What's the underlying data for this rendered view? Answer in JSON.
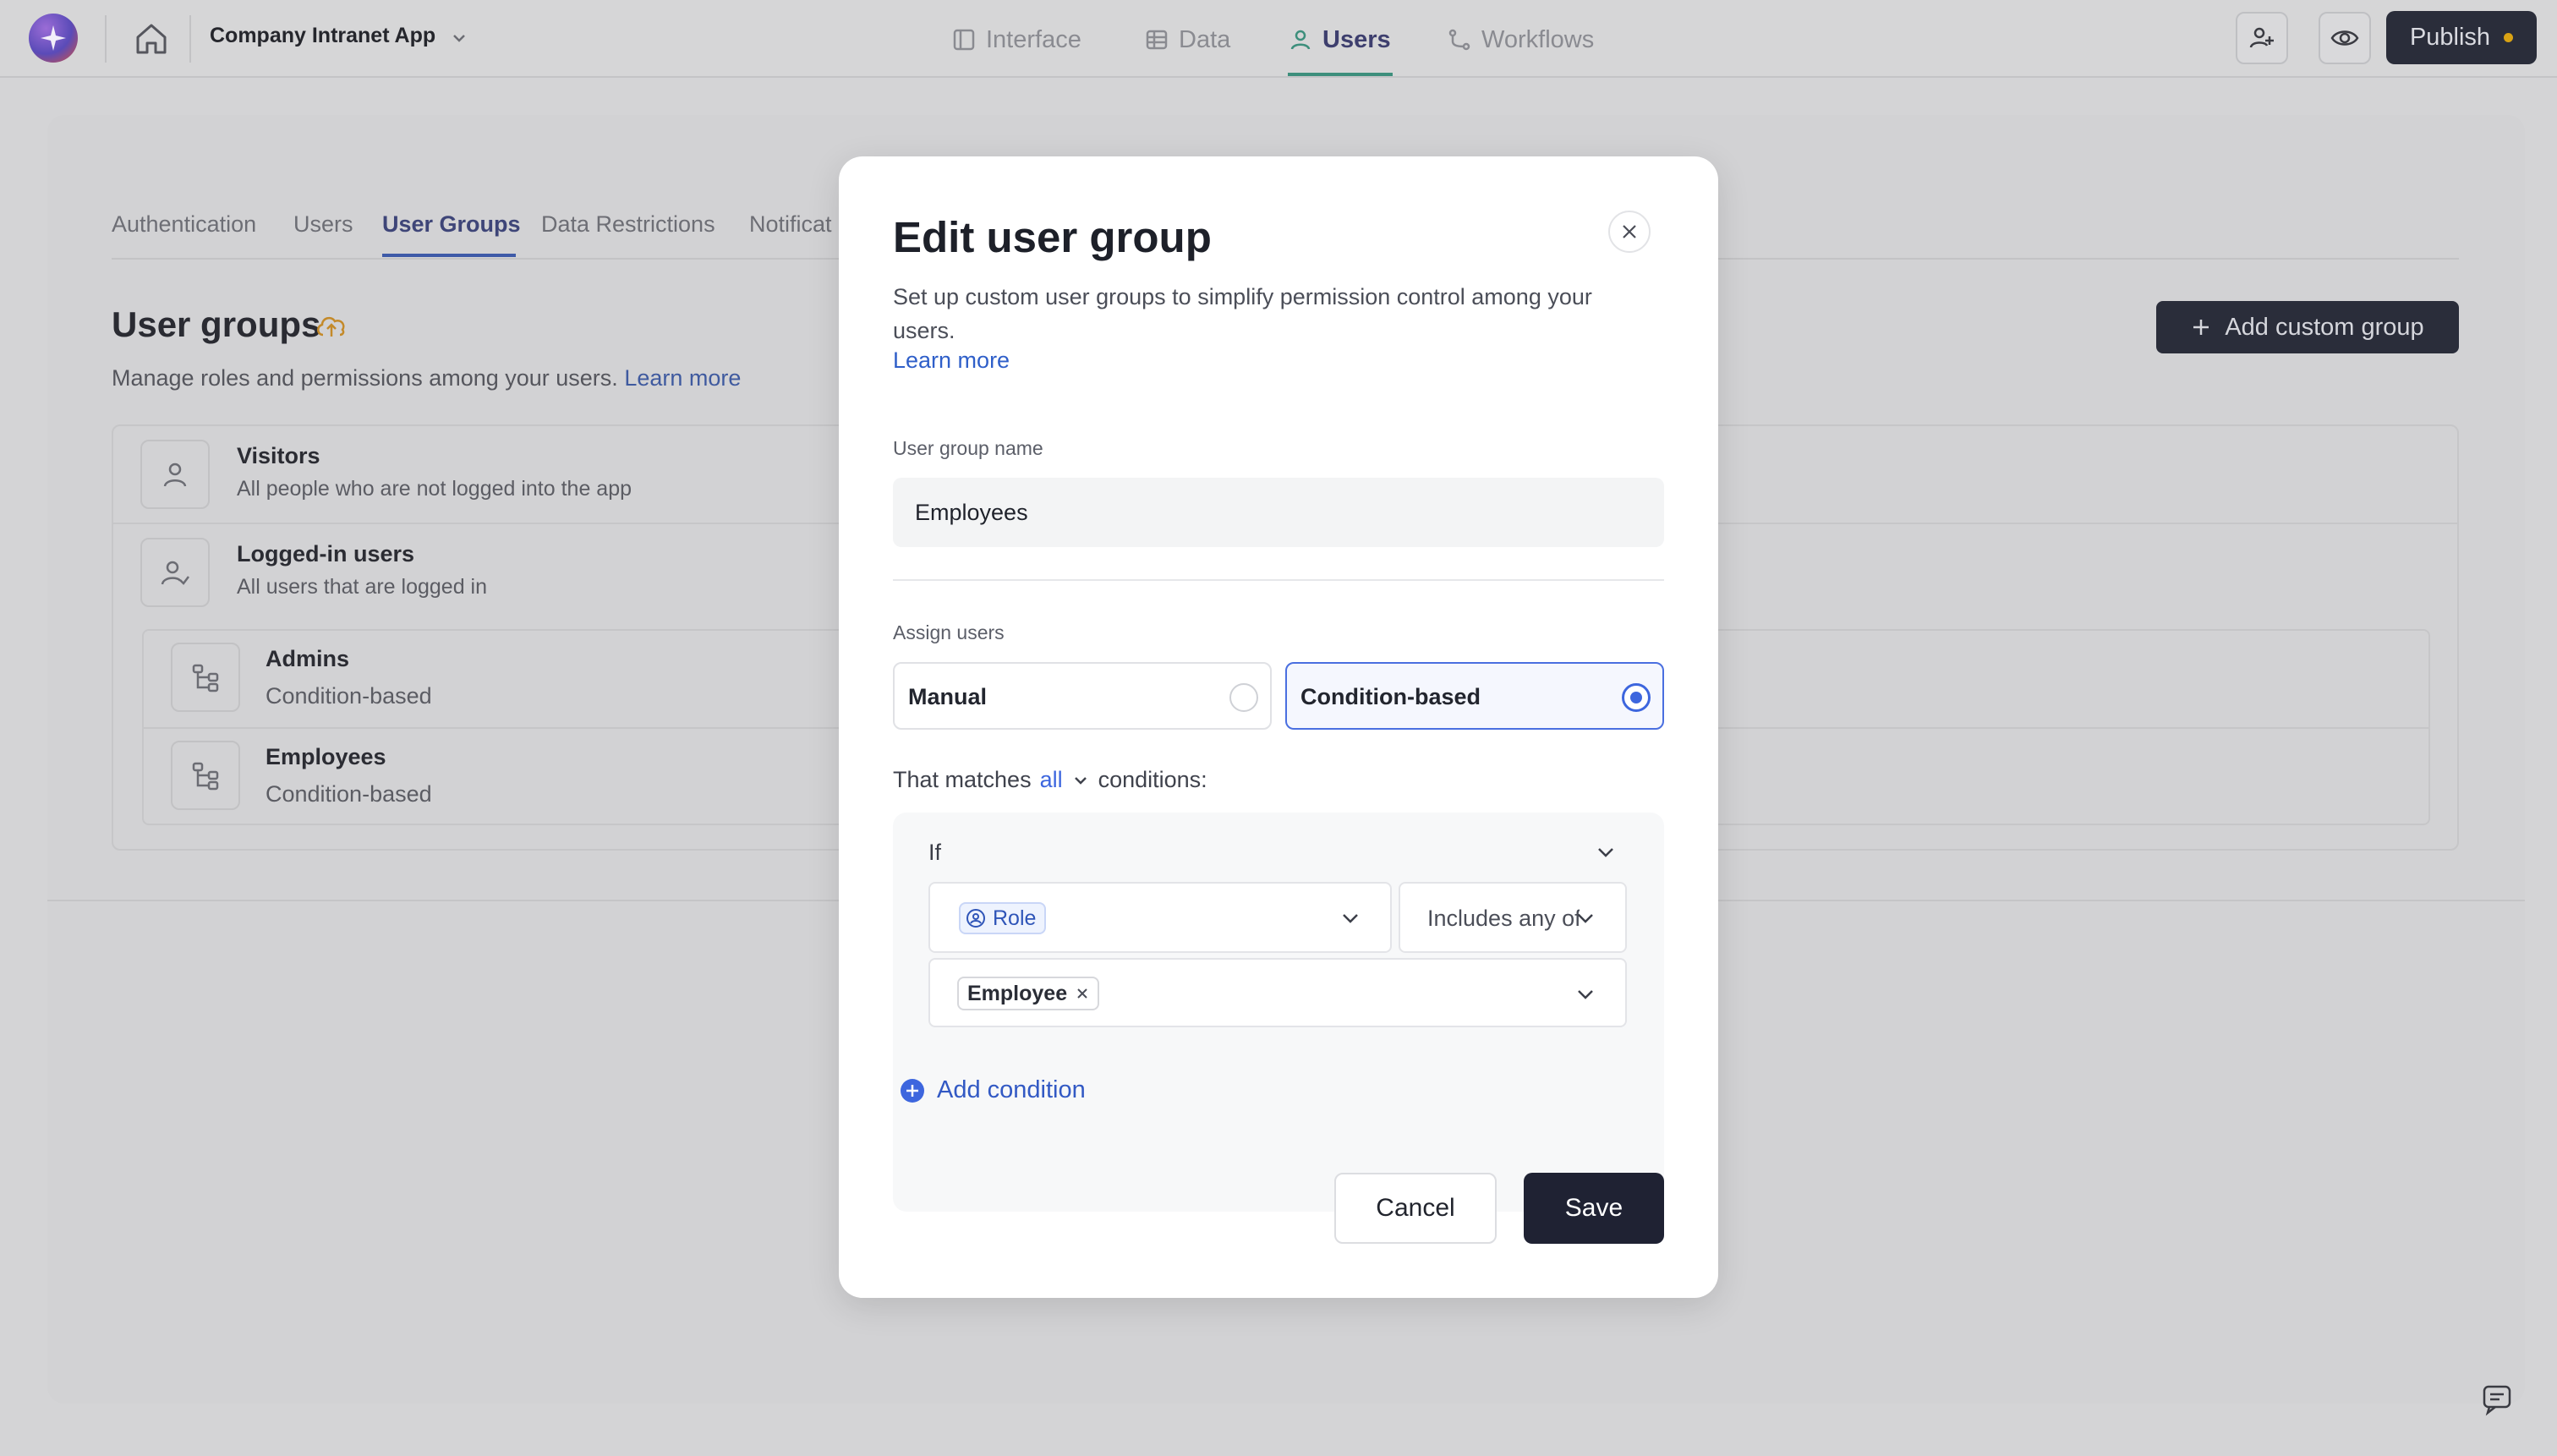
{
  "topbar": {
    "app_name": "Company Intranet App",
    "tabs": [
      {
        "label": "Interface",
        "icon": "layout-icon"
      },
      {
        "label": "Data",
        "icon": "table-icon"
      },
      {
        "label": "Users",
        "icon": "user-icon"
      },
      {
        "label": "Workflows",
        "icon": "workflow-icon"
      }
    ],
    "active_tab": "Users",
    "publish_label": "Publish",
    "publish_status_color": "#d9a214"
  },
  "page": {
    "subtabs": [
      "Authentication",
      "Users",
      "User Groups",
      "Data Restrictions",
      "Notificat"
    ],
    "active_subtab": "User Groups",
    "title": "User groups",
    "subtitle": "Manage roles and permissions among your users.",
    "learn_more": "Learn more",
    "add_group_label": "Add custom group",
    "groups": [
      {
        "name": "Visitors",
        "description": "All people who are not logged into the app",
        "icon": "user-icon"
      },
      {
        "name": "Logged-in users",
        "description": "All users that are logged in",
        "icon": "user-check-icon"
      },
      {
        "name": "Admins",
        "description": "Condition-based",
        "icon": "hierarchy-icon"
      },
      {
        "name": "Employees",
        "description": "Condition-based",
        "icon": "hierarchy-icon"
      }
    ]
  },
  "modal": {
    "title": "Edit user group",
    "description": "Set up custom user groups to simplify permission control among your users.",
    "learn_more": "Learn more",
    "name_label": "User group name",
    "name_value": "Employees",
    "assign_label": "Assign users",
    "assign_options": [
      "Manual",
      "Condition-based"
    ],
    "assign_selected": "Condition-based",
    "matches_prefix": "That matches",
    "matches_value": "all",
    "matches_suffix": "conditions:",
    "condition": {
      "if_label": "If",
      "field": "Role",
      "operator": "Includes any of",
      "values": [
        "Employee"
      ]
    },
    "add_condition_label": "Add condition",
    "cancel_label": "Cancel",
    "save_label": "Save"
  },
  "colors": {
    "accent": "#3d66de",
    "dark_button": "#1f2233",
    "overlay": "#d4d4d6"
  }
}
